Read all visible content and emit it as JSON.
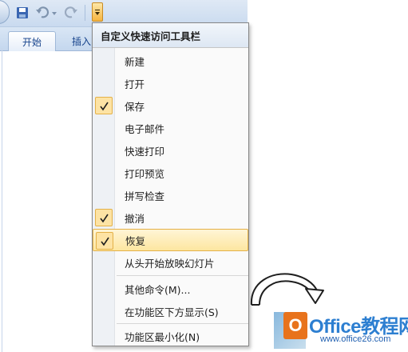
{
  "ribbon": {
    "tabs": [
      {
        "label": "开始"
      },
      {
        "label": "插入"
      }
    ]
  },
  "quick_access": {
    "icons": [
      "save-icon",
      "undo-icon",
      "redo-icon",
      "customize-dropdown-icon"
    ]
  },
  "menu": {
    "title": "自定义快速访问工具栏",
    "items": [
      {
        "label": "新建",
        "checked": false
      },
      {
        "label": "打开",
        "checked": false
      },
      {
        "label": "保存",
        "checked": true
      },
      {
        "label": "电子邮件",
        "checked": false
      },
      {
        "label": "快速打印",
        "checked": false
      },
      {
        "label": "打印预览",
        "checked": false
      },
      {
        "label": "拼写检查",
        "checked": false
      },
      {
        "label": "撤消",
        "checked": true
      },
      {
        "label": "恢复",
        "checked": true,
        "highlighted": true
      },
      {
        "label": "从头开始放映幻灯片",
        "checked": false
      },
      {
        "label": "其他命令(M)..."
      },
      {
        "label": "在功能区下方显示(S)"
      },
      {
        "label": "功能区最小化(N)"
      }
    ]
  },
  "watermark": {
    "logo_text": "Office教程网",
    "url": "www.office26.com"
  },
  "colors": {
    "check_bg": "#fde3a4",
    "highlight": "#fde6a0",
    "ribbon_text": "#15428b",
    "logo_orange": "#e8731c",
    "logo_blue": "#2d7fd1"
  }
}
